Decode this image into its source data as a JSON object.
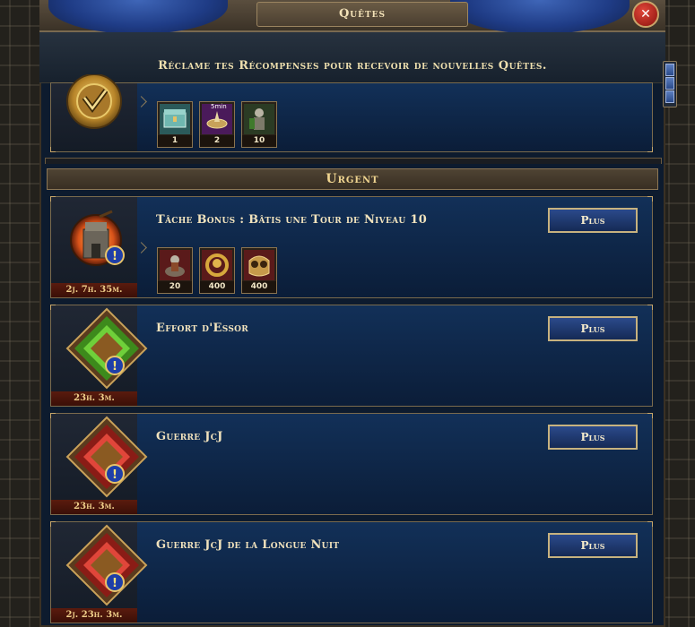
{
  "window": {
    "title": "Quêtes",
    "close_label": "✕"
  },
  "banner": {
    "text": "Réclame tes Récompenses pour recevoir de nouvelles Quêtes."
  },
  "top_quest": {
    "rewards": [
      {
        "icon": "chest-icon",
        "qty": "1"
      },
      {
        "icon": "speedup-5min-icon",
        "qty": "2",
        "badge": "5min"
      },
      {
        "icon": "soldier-icon",
        "qty": "10"
      }
    ]
  },
  "section": {
    "urgent_label": "Urgent"
  },
  "quests": [
    {
      "title": "Tâche Bonus : Bâtis une Tour de Niveau 10",
      "timer": "2j. 7h. 35m.",
      "button": "Plus",
      "rewards": [
        {
          "icon": "cavalry-icon",
          "qty": "20"
        },
        {
          "icon": "laurel-medal-icon",
          "qty": "400"
        },
        {
          "icon": "owl-helmet-icon",
          "qty": "400"
        }
      ]
    },
    {
      "title": "Effort d'Essor",
      "timer": "23h. 3m.",
      "button": "Plus"
    },
    {
      "title": "Guerre JcJ",
      "timer": "23h. 3m.",
      "button": "Plus"
    },
    {
      "title": "Guerre JcJ de la Longue Nuit",
      "timer": "2j. 23h. 3m.",
      "button": "Plus"
    }
  ],
  "colors": {
    "gold": "#c7b27f",
    "panel": "#0d1b2e",
    "green_diamond": "#56b52e",
    "red_diamond": "#c7312a"
  }
}
